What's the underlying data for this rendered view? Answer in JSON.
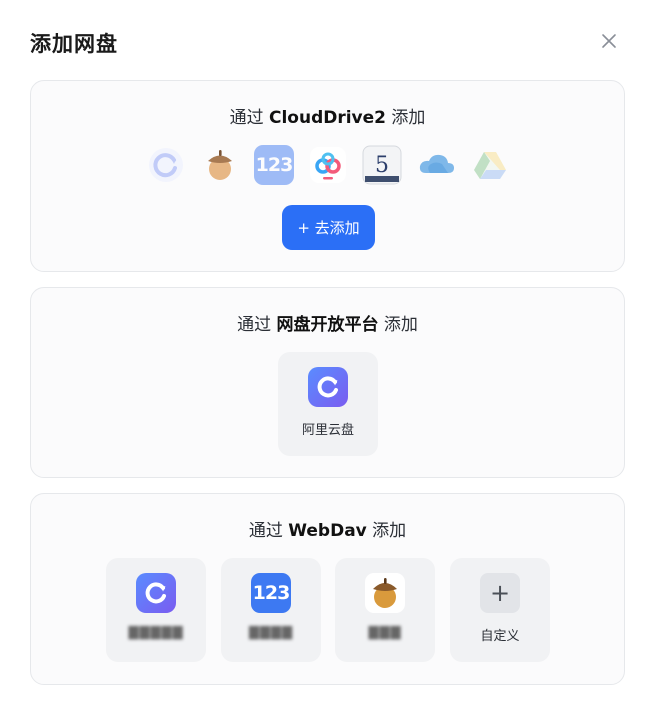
{
  "dialog": {
    "title": "添加网盘"
  },
  "sections": {
    "clouddrive": {
      "prefix": "通过 ",
      "bold": "CloudDrive2",
      "suffix": " 添加",
      "logos": [
        "aliyun-drive-icon",
        "acorn-drive-icon",
        "pan123-icon",
        "baidu-netdisk-icon",
        "drive-115-icon",
        "onedrive-icon",
        "google-drive-icon"
      ],
      "button": "+ 去添加"
    },
    "openplatform": {
      "prefix": "通过 ",
      "bold": "网盘开放平台",
      "suffix": " 添加",
      "tiles": [
        {
          "icon": "aliyun-drive-icon",
          "label": "阿里云盘"
        }
      ]
    },
    "webdav": {
      "prefix": "通过 ",
      "bold": "WebDav",
      "suffix": " 添加",
      "tiles": [
        {
          "icon": "aliyun-drive-icon",
          "label": "▇▇▇▇▇"
        },
        {
          "icon": "pan123-icon",
          "label": "▇▇▇▇"
        },
        {
          "icon": "acorn-drive-icon",
          "label": "▇▇▇"
        },
        {
          "icon": "plus-icon",
          "label": "自定义"
        }
      ]
    }
  },
  "colors": {
    "accent": "#2b6ff6",
    "card_bg": "#fbfbfc",
    "tile_bg": "#f1f2f4"
  }
}
